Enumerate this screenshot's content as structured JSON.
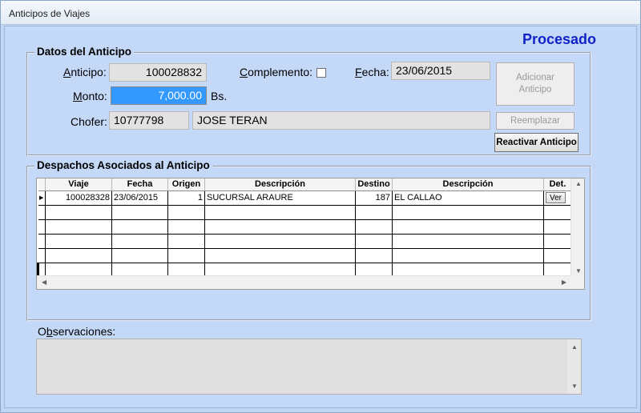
{
  "window": {
    "title": "Anticipos de Viajes"
  },
  "status": "Procesado",
  "datos": {
    "legend": "Datos del Anticipo",
    "anticipo_label_u": "A",
    "anticipo_label_rest": "nticipo:",
    "anticipo_value": "100028832",
    "complemento_label_u": "C",
    "complemento_label_rest": "omplemento:",
    "complemento_checked": false,
    "fecha_label_u": "F",
    "fecha_label_rest": "echa:",
    "fecha_value": "23/06/2015",
    "monto_label_u": "M",
    "monto_label_rest": "onto:",
    "monto_value": "7,000.00",
    "monto_unit": "Bs.",
    "chofer_label": "Chofer:",
    "chofer_id": "10777798",
    "chofer_name": "JOSE TERAN"
  },
  "buttons": {
    "adicionar_line1": "Adicionar",
    "adicionar_line2": "Anticipo",
    "reemplazar": "Reemplazar",
    "reactivar": "Reactivar Anticipo",
    "ver": "Ver"
  },
  "despachos": {
    "legend": "Despachos Asociados al Anticipo",
    "columns": [
      "Viaje",
      "Fecha",
      "Origen",
      "Descripción",
      "Destino",
      "Descripción",
      "Det."
    ],
    "rows": [
      {
        "viaje": "100028328",
        "fecha": "23/06/2015",
        "origen": "1",
        "desc_origen": "SUCURSAL ARAURE",
        "destino": "187",
        "desc_destino": "EL CALLAO"
      }
    ]
  },
  "observaciones": {
    "label_pre": "O",
    "label_u": "b",
    "label_rest": "servaciones:",
    "value": ""
  }
}
